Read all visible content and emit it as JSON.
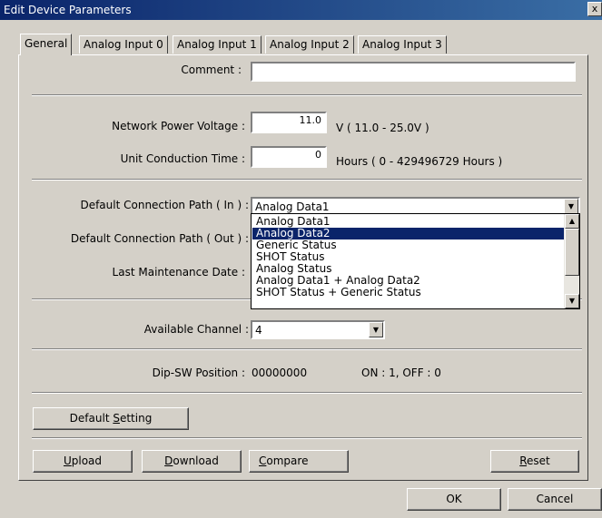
{
  "window": {
    "title": "Edit Device Parameters",
    "close_glyph": "x"
  },
  "tabs": [
    {
      "label": "General"
    },
    {
      "label": "Analog Input 0"
    },
    {
      "label": "Analog Input 1"
    },
    {
      "label": "Analog Input 2"
    },
    {
      "label": "Analog Input 3"
    }
  ],
  "comment": {
    "label": "Comment :",
    "value": ""
  },
  "network_power_voltage": {
    "label": "Network Power Voltage :",
    "value": "11.0",
    "unit": "V ( 11.0 - 25.0V )"
  },
  "unit_conduction_time": {
    "label": "Unit Conduction Time :",
    "value": "0",
    "unit": "Hours ( 0 - 429496729 Hours )"
  },
  "connection_in": {
    "label": "Default Connection Path ( In ) :",
    "value": "Analog Data1"
  },
  "connection_out": {
    "label": "Default Connection Path ( Out ) :"
  },
  "last_maintenance": {
    "label": "Last Maintenance Date :"
  },
  "dropdown": {
    "options": [
      "Analog Data1",
      "Analog Data2",
      "Generic Status",
      "SHOT Status",
      "Analog Status",
      "Analog Data1 + Analog Data2",
      "SHOT Status + Generic Status"
    ],
    "selected_index": 1
  },
  "available_channel": {
    "label": "Available Channel :",
    "value": "4"
  },
  "dip_sw": {
    "label": "Dip-SW Position :",
    "value": "00000000",
    "legend": "ON : 1, OFF : 0"
  },
  "buttons": {
    "default_setting": {
      "pre": "Default ",
      "key": "S",
      "post": "etting"
    },
    "upload": {
      "key": "U",
      "post": "pload"
    },
    "download": {
      "key": "D",
      "post": "ownload"
    },
    "compare": {
      "key": "C",
      "post": "ompare"
    },
    "reset": {
      "key": "R",
      "post": "eset"
    },
    "ok": "OK",
    "cancel": "Cancel"
  },
  "colors": {
    "titlebar": "#0a246a",
    "face": "#d4d0c8",
    "selection": "#0a246a"
  }
}
